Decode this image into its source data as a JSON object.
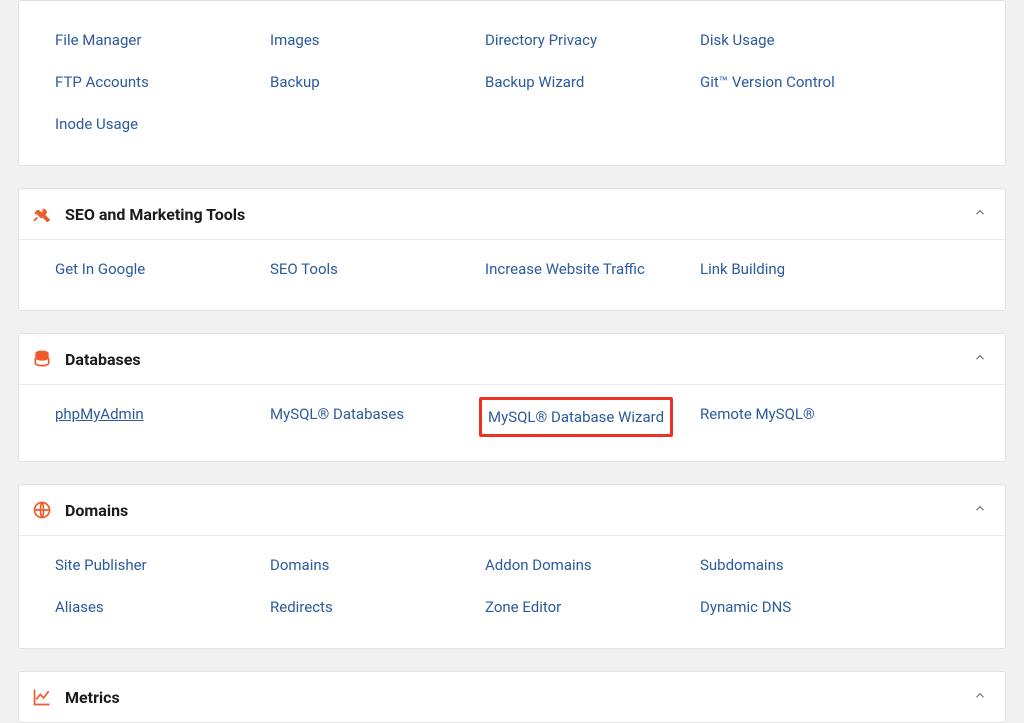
{
  "sections": {
    "files": {
      "items": [
        "File Manager",
        "Images",
        "Directory Privacy",
        "Disk Usage",
        "FTP Accounts",
        "Backup",
        "Backup Wizard",
        "Git™ Version Control",
        "Inode Usage"
      ]
    },
    "seo": {
      "title": "SEO and Marketing Tools",
      "items": [
        "Get In Google",
        "SEO Tools",
        "Increase Website Traffic",
        "Link Building"
      ]
    },
    "databases": {
      "title": "Databases",
      "items": [
        "phpMyAdmin",
        "MySQL® Databases",
        "MySQL® Database Wizard",
        "Remote MySQL®"
      ]
    },
    "domains": {
      "title": "Domains",
      "items": [
        "Site Publisher",
        "Domains",
        "Addon Domains",
        "Subdomains",
        "Aliases",
        "Redirects",
        "Zone Editor",
        "Dynamic DNS"
      ]
    },
    "metrics": {
      "title": "Metrics"
    }
  }
}
